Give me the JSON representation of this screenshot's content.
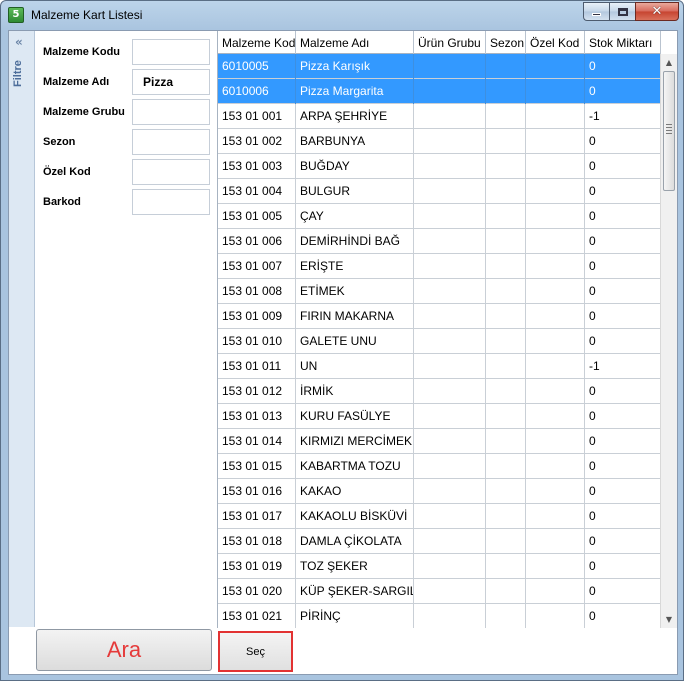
{
  "window": {
    "title": "Malzeme Kart Listesi",
    "app_icon_text": "5",
    "minimize_label": "_",
    "maximize_label": "□",
    "close_label": "✕"
  },
  "filter_strip": {
    "label": "Filtre",
    "collapse_glyph": "«"
  },
  "filters": [
    {
      "label": "Malzeme Kodu",
      "value": ""
    },
    {
      "label": "Malzeme Adı",
      "value": "Pizza"
    },
    {
      "label": "Malzeme Grubu",
      "value": ""
    },
    {
      "label": "Sezon",
      "value": ""
    },
    {
      "label": "Özel Kod",
      "value": ""
    },
    {
      "label": "Barkod",
      "value": ""
    }
  ],
  "grid": {
    "columns": [
      "Malzeme Kodu",
      "Malzeme Adı",
      "Ürün Grubu",
      "Sezon",
      "Özel Kod",
      "Stok Miktarı"
    ],
    "rows": [
      {
        "code": "6010005",
        "name": "Pizza Karışık",
        "group": "",
        "season": "",
        "special": "",
        "stock": "0",
        "selected": true
      },
      {
        "code": "6010006",
        "name": "Pizza Margarita",
        "group": "",
        "season": "",
        "special": "",
        "stock": "0",
        "selected": true
      },
      {
        "code": "153 01 001",
        "name": "ARPA ŞEHRİYE",
        "group": "",
        "season": "",
        "special": "",
        "stock": "-1",
        "selected": false
      },
      {
        "code": "153 01 002",
        "name": "BARBUNYA",
        "group": "",
        "season": "",
        "special": "",
        "stock": "0",
        "selected": false
      },
      {
        "code": "153 01 003",
        "name": "BUĞDAY",
        "group": "",
        "season": "",
        "special": "",
        "stock": "0",
        "selected": false
      },
      {
        "code": "153 01 004",
        "name": "BULGUR",
        "group": "",
        "season": "",
        "special": "",
        "stock": "0",
        "selected": false
      },
      {
        "code": "153 01 005",
        "name": "ÇAY",
        "group": "",
        "season": "",
        "special": "",
        "stock": "0",
        "selected": false
      },
      {
        "code": "153 01 006",
        "name": "DEMİRHİNDİ BAĞ",
        "group": "",
        "season": "",
        "special": "",
        "stock": "0",
        "selected": false
      },
      {
        "code": "153 01 007",
        "name": "ERİŞTE",
        "group": "",
        "season": "",
        "special": "",
        "stock": "0",
        "selected": false
      },
      {
        "code": "153 01 008",
        "name": "ETİMEK",
        "group": "",
        "season": "",
        "special": "",
        "stock": "0",
        "selected": false
      },
      {
        "code": "153 01 009",
        "name": "FIRIN MAKARNA",
        "group": "",
        "season": "",
        "special": "",
        "stock": "0",
        "selected": false
      },
      {
        "code": "153 01 010",
        "name": "GALETE UNU",
        "group": "",
        "season": "",
        "special": "",
        "stock": "0",
        "selected": false
      },
      {
        "code": "153 01 011",
        "name": "UN",
        "group": "",
        "season": "",
        "special": "",
        "stock": "-1",
        "selected": false
      },
      {
        "code": "153 01 012",
        "name": "İRMİK",
        "group": "",
        "season": "",
        "special": "",
        "stock": "0",
        "selected": false
      },
      {
        "code": "153 01 013",
        "name": "KURU FASÜLYE",
        "group": "",
        "season": "",
        "special": "",
        "stock": "0",
        "selected": false
      },
      {
        "code": "153 01 014",
        "name": "KIRMIZI MERCİMEK",
        "group": "",
        "season": "",
        "special": "",
        "stock": "0",
        "selected": false
      },
      {
        "code": "153 01 015",
        "name": "KABARTMA TOZU",
        "group": "",
        "season": "",
        "special": "",
        "stock": "0",
        "selected": false
      },
      {
        "code": "153 01 016",
        "name": "KAKAO",
        "group": "",
        "season": "",
        "special": "",
        "stock": "0",
        "selected": false
      },
      {
        "code": "153 01 017",
        "name": "KAKAOLU BİSKÜVİ",
        "group": "",
        "season": "",
        "special": "",
        "stock": "0",
        "selected": false
      },
      {
        "code": "153 01 018",
        "name": "DAMLA ÇİKOLATA",
        "group": "",
        "season": "",
        "special": "",
        "stock": "0",
        "selected": false
      },
      {
        "code": "153 01 019",
        "name": "TOZ ŞEKER",
        "group": "",
        "season": "",
        "special": "",
        "stock": "0",
        "selected": false
      },
      {
        "code": "153 01 020",
        "name": "KÜP ŞEKER-SARGILI",
        "group": "",
        "season": "",
        "special": "",
        "stock": "0",
        "selected": false
      },
      {
        "code": "153 01 021",
        "name": "PİRİNÇ",
        "group": "",
        "season": "",
        "special": "",
        "stock": "0",
        "selected": false
      }
    ]
  },
  "buttons": {
    "search": "Ara",
    "select": "Seç"
  },
  "colors": {
    "selection": "#3399ff",
    "search_text": "#e53a3a",
    "select_border": "#e23232"
  }
}
